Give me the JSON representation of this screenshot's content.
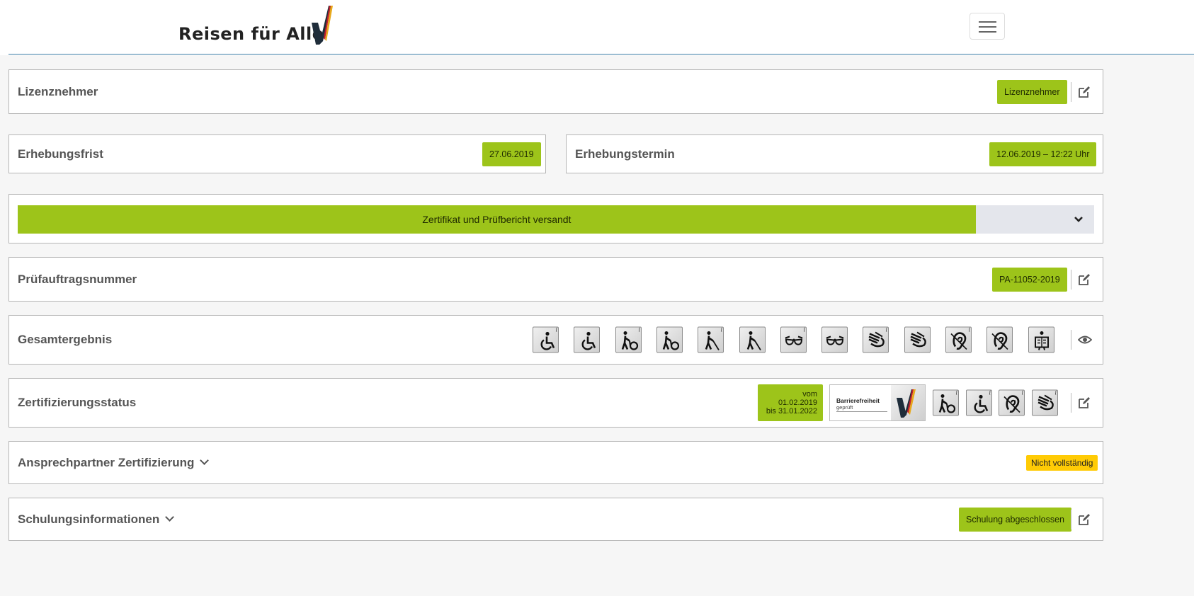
{
  "header": {
    "brand_name": "Reisen für Alle",
    "menu_icon": "hamburger-menu-icon"
  },
  "colors": {
    "accent_green": "#9dc41a",
    "warning_yellow": "#ffcb05",
    "header_rule": "#3a7ca5",
    "track_grey": "#e4e6ec"
  },
  "licensee": {
    "title": "Lizenznehmer",
    "badge": "Lizenznehmer",
    "action_icon": "edit-icon"
  },
  "deadline": {
    "title": "Erhebungsfrist",
    "value": "27.06.2019"
  },
  "appointment": {
    "title": "Erhebungstermin",
    "value": "12.06.2019 – 12:22 Uhr"
  },
  "status_progress": {
    "label": "Zertifikat und Prüfbericht versandt",
    "progress_fraction": 0.89,
    "toggle_icon": "chevron-down-icon"
  },
  "order_number": {
    "title": "Prüfauftragsnummer",
    "value": "PA-11052-2019",
    "action_icon": "edit-icon"
  },
  "overall_result": {
    "title": "Gesamtergebnis",
    "icons": [
      {
        "name": "wheelchair-info-icon",
        "has_info": true
      },
      {
        "name": "wheelchair-icon",
        "has_info": false
      },
      {
        "name": "walking-impairment-info-icon",
        "has_info": true
      },
      {
        "name": "walking-impairment-icon",
        "has_info": false
      },
      {
        "name": "blind-cane-info-icon",
        "has_info": true
      },
      {
        "name": "blind-cane-icon",
        "has_info": false
      },
      {
        "name": "visual-impairment-info-icon",
        "has_info": true
      },
      {
        "name": "visual-impairment-icon",
        "has_info": false
      },
      {
        "name": "sign-language-info-icon",
        "has_info": true
      },
      {
        "name": "sign-language-icon",
        "has_info": false
      },
      {
        "name": "hearing-impairment-info-icon",
        "has_info": true
      },
      {
        "name": "hearing-impairment-icon",
        "has_info": false
      },
      {
        "name": "cognitive-impairment-icon",
        "has_info": false
      }
    ],
    "action_icon": "eye-icon",
    "info_mark": "i"
  },
  "certification_status": {
    "title": "Zertifizierungsstatus",
    "valid_from": "vom 01.02.2019",
    "valid_to": "bis 31.01.2022",
    "seal_title": "Barrierefreiheit",
    "seal_subtitle": "geprüft",
    "icons": [
      {
        "name": "walking-impairment-info-icon"
      },
      {
        "name": "wheelchair-info-icon"
      },
      {
        "name": "hearing-impairment-info-icon"
      },
      {
        "name": "sign-language-info-icon"
      }
    ],
    "action_icon": "edit-icon"
  },
  "certification_contact": {
    "title": "Ansprechpartner Zertifizierung",
    "badge": "Nicht vollständig"
  },
  "training": {
    "title": "Schulungsinformationen",
    "badge": "Schulung abgeschlossen",
    "action_icon": "edit-icon"
  }
}
